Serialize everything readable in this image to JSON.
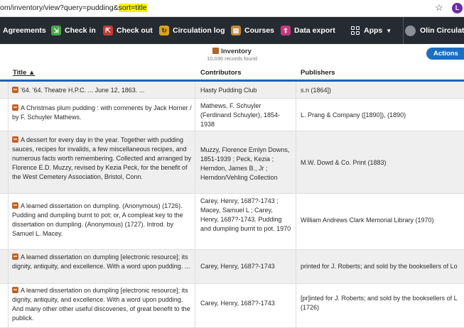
{
  "browser": {
    "url_prefix": "om/inventory/view?query=pudding&",
    "url_highlight": "sort=title",
    "profile_initial": "L"
  },
  "nav": {
    "items": [
      {
        "label": "Agreements",
        "icon": ""
      },
      {
        "label": "Check in",
        "icon": "check-in-icon"
      },
      {
        "label": "Check out",
        "icon": "check-out-icon"
      },
      {
        "label": "Circulation log",
        "icon": "circulation-log-icon"
      },
      {
        "label": "Courses",
        "icon": "courses-icon"
      },
      {
        "label": "Data export",
        "icon": "data-export-icon"
      }
    ],
    "apps_label": "Apps",
    "user_label": "Olin Circulatio"
  },
  "inventory": {
    "title": "Inventory",
    "count": "10,036 records found",
    "actions_label": "Actions"
  },
  "table": {
    "headers": {
      "title": "Title",
      "contributors": "Contributors",
      "publishers": "Publishers"
    },
    "rows": [
      {
        "title": "'64. '64. Theatre H.P.C. ... June 12, 1863. ...",
        "contributors": "Hasty Pudding Club",
        "publishers": "s.n (1864])"
      },
      {
        "title": "A Christmas plum pudding : with comments by Jack Horner / by F. Schuyler Mathews.",
        "contributors": "Mathews, F. Schuyler (Ferdinand Schuyler), 1854-1938",
        "publishers": "L. Prang & Company ([1890]), (1890)"
      },
      {
        "title": "A dessert for every day in the year. Together with pudding sauces, recipes for invalids, a few miscellaneous recipes, and numerous facts worth remembering. Collected and arranged by Florence E.D. Muzzy, revised by Kezia Peck, for the benefit of the West Cemetery Association, Bristol, Conn.",
        "contributors": "Muzzy, Florence Emlyn Downs, 1851-1939 ; Peck, Kezia ; Herndon, James B., Jr ; Herndon/Vehling Collection",
        "publishers": "M.W. Dowd & Co. Print (1883)"
      },
      {
        "title": "A learned dissertation on dumpling. (Anonymous) (1726). Pudding and dumpling burnt to pot; or, A compleat key to the dissertation on dumpling. (Anonymous) (1727). Introd. by Samuel L. Macey.",
        "contributors": "Carey, Henry, 1687?-1743 ; Macey, Samuel L ; Carey, Henry, 1687?-1743. Pudding and dumpling burnt to pot. 1970",
        "publishers": "William Andrews Clark Memorial Library (1970)"
      },
      {
        "title": "A learned dissertation on dumpling [electronic resource]; its dignity, antiquity, and excellence. With a word upon pudding. ...",
        "contributors": "Carey, Henry, 1687?-1743",
        "publishers": "printed for J. Roberts; and sold by the booksellers of Lo"
      },
      {
        "title": "A learned dissertation on dumpling [electronic resource]; its dignity, antiquity, and excellence. With a word upon pudding. And many other other useful discoveries, of great benefit to the publick.",
        "contributors": "Carey, Henry, 1687?-1743",
        "publishers": "[pr]inted for J. Roberts; and sold by the booksellers of L (1726)"
      }
    ]
  }
}
